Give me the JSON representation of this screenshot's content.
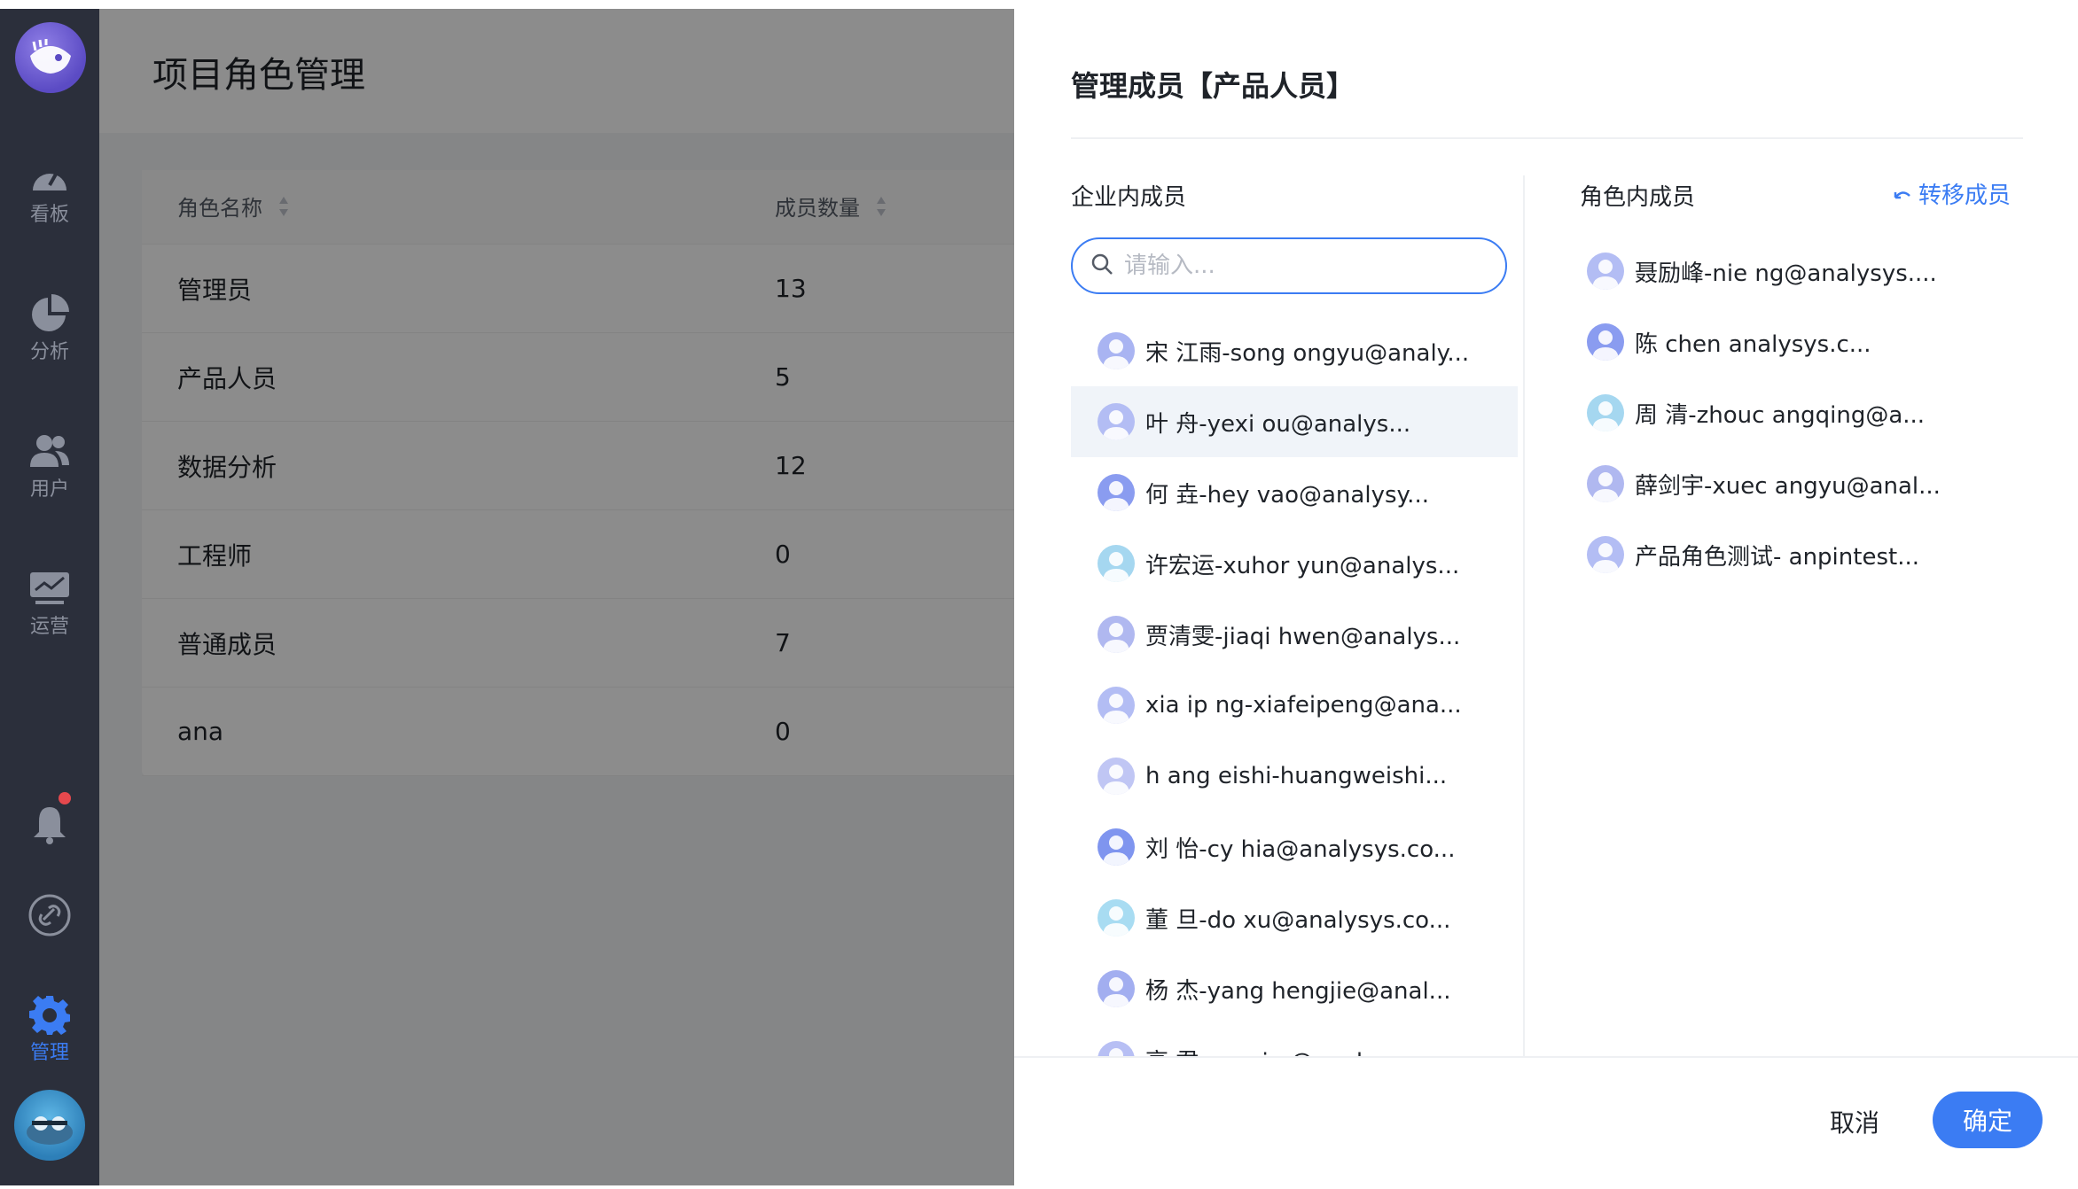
{
  "sidebar": {
    "items": [
      {
        "label": "看板",
        "icon": "gauge-icon"
      },
      {
        "label": "分析",
        "icon": "pie-chart-icon"
      },
      {
        "label": "用户",
        "icon": "users-icon"
      },
      {
        "label": "运营",
        "icon": "monitor-icon"
      },
      {
        "label": "管理",
        "icon": "gear-icon"
      }
    ]
  },
  "page": {
    "title": "项目角色管理",
    "table": {
      "headers": [
        "角色名称",
        "成员数量"
      ],
      "rows": [
        {
          "name": "管理员",
          "count": "13"
        },
        {
          "name": "产品人员",
          "count": "5"
        },
        {
          "name": "数据分析",
          "count": "12"
        },
        {
          "name": "工程师",
          "count": "0"
        },
        {
          "name": "普通成员",
          "count": "7"
        },
        {
          "name": "ana",
          "count": "0"
        }
      ]
    }
  },
  "drawer": {
    "title": "管理成员【产品人员】",
    "enterprise_title": "企业内成员",
    "role_title": "角色内成员",
    "transfer_label": "转移成员",
    "search_placeholder": "请输入...",
    "enterprise_members": [
      "宋 江雨-song ongyu@analy...",
      "叶  舟-yexi   ou@analys...",
      "何  垚-hey  vao@analysy...",
      "许宏运-xuhor  yun@analys...",
      "贾清雯-jiaqi  hwen@analys...",
      "xia  ip  ng-xiafeipeng@ana...",
      "h  ang  eishi-huangweishi...",
      "刘  怡-cy  hia@analysys.co...",
      "董  旦-do  xu@analysys.co...",
      "杨  杰-yang  hengjie@anal...",
      "高  君-gaosi  n@analysys..."
    ],
    "role_members": [
      "聂励峰-nie  ng@analysys....",
      "陈   chen   analysys.c...",
      "周  清-zhouc  angqing@a...",
      "薛剑宇-xuec  angyu@anal...",
      "产品角色测试-  anpintest..."
    ],
    "cancel_label": "取消",
    "ok_label": "确定"
  },
  "colors": {
    "accent": "#3b7cf3",
    "sidebar_bg": "#2b2f3b",
    "notification": "#e5484d"
  }
}
